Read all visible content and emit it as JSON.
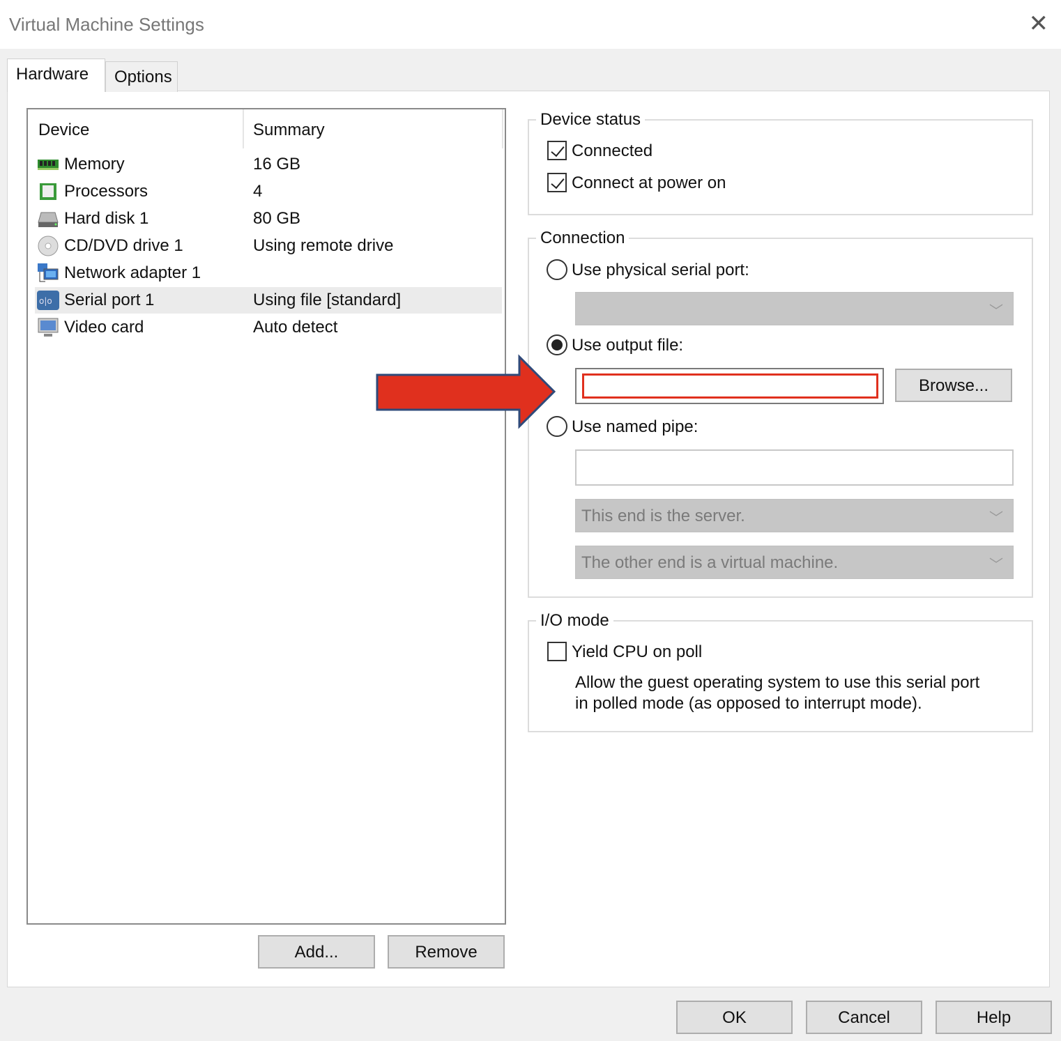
{
  "window": {
    "title": "Virtual Machine Settings"
  },
  "tabs": [
    {
      "label": "Hardware"
    },
    {
      "label": "Options"
    }
  ],
  "device_list": {
    "headers": {
      "device": "Device",
      "summary": "Summary"
    },
    "rows": [
      {
        "name": "Memory",
        "summary": "16 GB",
        "icon": "memory-icon"
      },
      {
        "name": "Processors",
        "summary": "4",
        "icon": "processor-icon"
      },
      {
        "name": "Hard disk 1",
        "summary": "80 GB",
        "icon": "hard-disk-icon"
      },
      {
        "name": "CD/DVD drive 1",
        "summary": "Using remote drive",
        "icon": "cd-dvd-icon"
      },
      {
        "name": "Network adapter 1",
        "summary": "",
        "icon": "network-adapter-icon"
      },
      {
        "name": "Serial port 1",
        "summary": "Using file [standard]",
        "icon": "serial-port-icon",
        "selected": true
      },
      {
        "name": "Video card",
        "summary": "Auto detect",
        "icon": "video-card-icon"
      }
    ]
  },
  "buttons": {
    "add": "Add...",
    "remove": "Remove",
    "browse": "Browse...",
    "ok": "OK",
    "cancel": "Cancel",
    "help": "Help"
  },
  "device_status": {
    "legend": "Device status",
    "connected": "Connected",
    "connect_at_power_on": "Connect at power on",
    "connected_checked": true,
    "power_on_checked": true
  },
  "connection": {
    "legend": "Connection",
    "physical": "Use physical serial port:",
    "output_file": "Use output file:",
    "output_file_value": "",
    "named_pipe": "Use named pipe:",
    "named_pipe_value": "",
    "pipe_end": "This end is the server.",
    "pipe_other_end": "The other end is a virtual machine.",
    "selected": "output_file"
  },
  "io_mode": {
    "legend": "I/O mode",
    "yield_cpu": "Yield CPU on poll",
    "yield_checked": false,
    "description_line1": "Allow the guest operating system to use this serial port",
    "description_line2": "in polled mode (as opposed to interrupt mode)."
  },
  "colors": {
    "arrow": "#e0301e",
    "arrow_border": "#2f4a7a",
    "highlight": "#e0301e"
  }
}
